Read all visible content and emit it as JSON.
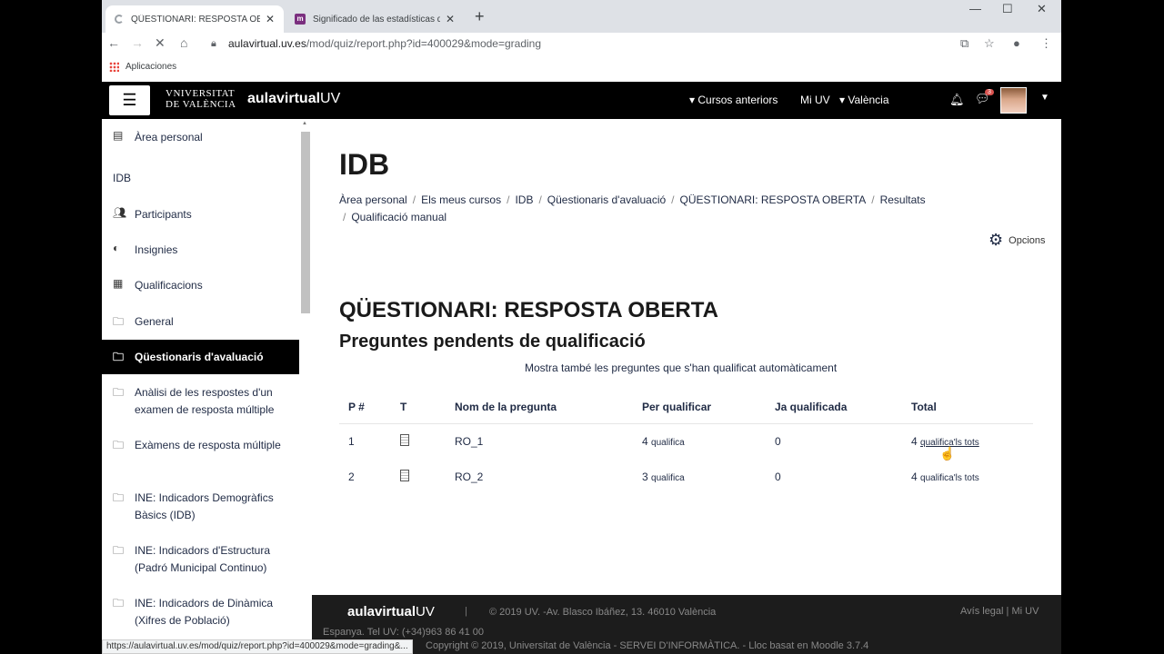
{
  "browser": {
    "tabs": [
      {
        "title": "QÜESTIONARI: RESPOSTA OBERTA",
        "active": true
      },
      {
        "title": "Significado de las estadísticas de",
        "active": false
      }
    ],
    "url_host": "aulavirtual.uv.es",
    "url_path": "/mod/quiz/report.php?id=400029&mode=grading",
    "bookmarks_label": "Aplicaciones",
    "status_url": "https://aulavirtual.uv.es/mod/quiz/report.php?id=400029&mode=grading&..."
  },
  "navbar": {
    "logo_line1": "VNIVERSITAT",
    "logo_line2": "DE VALÈNCIA",
    "aula_brand": "aulavirtual",
    "aula_uv": "UV",
    "links": [
      "Cursos anteriors",
      "Mi UV",
      "València"
    ],
    "chat_count": "3"
  },
  "sidebar": {
    "items": [
      {
        "label": "Àrea personal",
        "icon": "id-card-icon"
      },
      {
        "label": "IDB",
        "icon": ""
      },
      {
        "label": "Participants",
        "icon": "users-icon"
      },
      {
        "label": "Insignies",
        "icon": "shield-icon"
      },
      {
        "label": "Qualificacions",
        "icon": "table-icon"
      },
      {
        "label": "General",
        "icon": "folder-icon"
      },
      {
        "label": "Qüestionaris d'avaluació",
        "icon": "folder-icon",
        "active": true
      },
      {
        "label": "Anàlisi de les respostes d'un examen de resposta múltiple",
        "icon": "folder-icon"
      },
      {
        "label": "Exàmens de resposta múltiple",
        "icon": "folder-icon"
      },
      {
        "label": "INE: Indicadors Demogràfics Bàsics (IDB)",
        "icon": "folder-icon"
      },
      {
        "label": "INE: Indicadors d'Estructura (Padró Municipal Continuo)",
        "icon": "folder-icon"
      },
      {
        "label": "INE: Indicadors de Dinàmica (Xifres de Població)",
        "icon": "folder-icon"
      }
    ]
  },
  "main": {
    "page_title": "IDB",
    "breadcrumb": [
      "Àrea personal",
      "Els meus cursos",
      "IDB",
      "Qüestionaris d'avaluació",
      "QÜESTIONARI: RESPOSTA OBERTA",
      "Resultats",
      "Qualificació manual"
    ],
    "options_label": "Opcions",
    "quiz_title": "QÜESTIONARI: RESPOSTA OBERTA",
    "subtitle": "Preguntes pendents de qualificació",
    "show_auto": "Mostra també les preguntes que s'han qualificat automàticament",
    "table": {
      "headers": [
        "P #",
        "T",
        "Nom de la pregunta",
        "Per qualificar",
        "Ja qualificada",
        "Total"
      ],
      "rows": [
        {
          "num": "1",
          "name": "RO_1",
          "to_grade": "4",
          "to_grade_link": "qualifica",
          "graded": "0",
          "total": "4",
          "total_link": "qualifica'ls tots"
        },
        {
          "num": "2",
          "name": "RO_2",
          "to_grade": "3",
          "to_grade_link": "qualifica",
          "graded": "0",
          "total": "4",
          "total_link": "qualifica'ls tots"
        }
      ]
    }
  },
  "footer": {
    "brand": "aulavirtual",
    "brand_uv": "UV",
    "separator": "|",
    "address": "© 2019 UV. -Av. Blasco Ibáñez, 13. 46010 València",
    "legal": "Avís legal | Mi UV",
    "phone": "Espanya. Tel UV: (+34)963 86 41 00",
    "copyright": "Copyright © 2019, Universitat de València - SERVEI D'INFORMÀTICA. - Lloc basat en Moodle 3.7.4"
  }
}
